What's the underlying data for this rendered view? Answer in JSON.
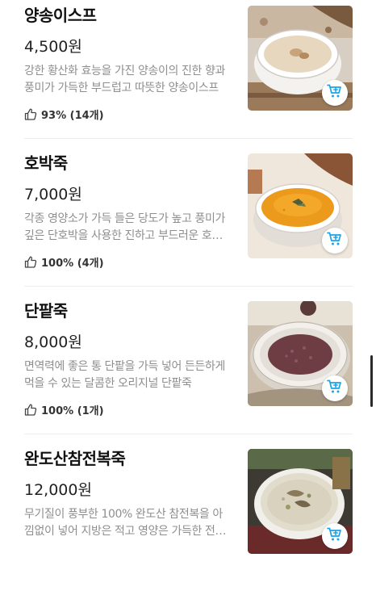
{
  "menu": {
    "items": [
      {
        "name": "양송이스프",
        "price": "4,500원",
        "description": "강한 황산화 효능을 가진 양송이의 진한 향과 풍미가 가득한 부드럽고 따뜻한 양송이스프",
        "rating": "93% (14개)"
      },
      {
        "name": "호박죽",
        "price": "7,000원",
        "description": "각종 영양소가 가득 들은 당도가 높고 풍미가 깊은 단호박을 사용한 진하고 부드러운 호박죽",
        "rating": "100% (4개)"
      },
      {
        "name": "단팥죽",
        "price": "8,000원",
        "description": "면역력에 좋은 통 단팥을 가득 넣어 든든하게 먹을 수 있는 달콤한 오리지널 단팥죽",
        "rating": "100% (1개)"
      },
      {
        "name": "완도산참전복죽",
        "price": "12,000원",
        "description": "무기질이 풍부한 100% 완도산 참전복을 아낌없이 넣어 지방은 적고 영양은 가득한 전복죽",
        "rating": ""
      }
    ]
  },
  "colors": {
    "accent_cart": "#1aa3e8",
    "text_primary": "#111111",
    "text_secondary": "#8e8e8e"
  },
  "icons": {
    "rating": "thumbs-up-icon",
    "cart": "cart-add-icon"
  }
}
